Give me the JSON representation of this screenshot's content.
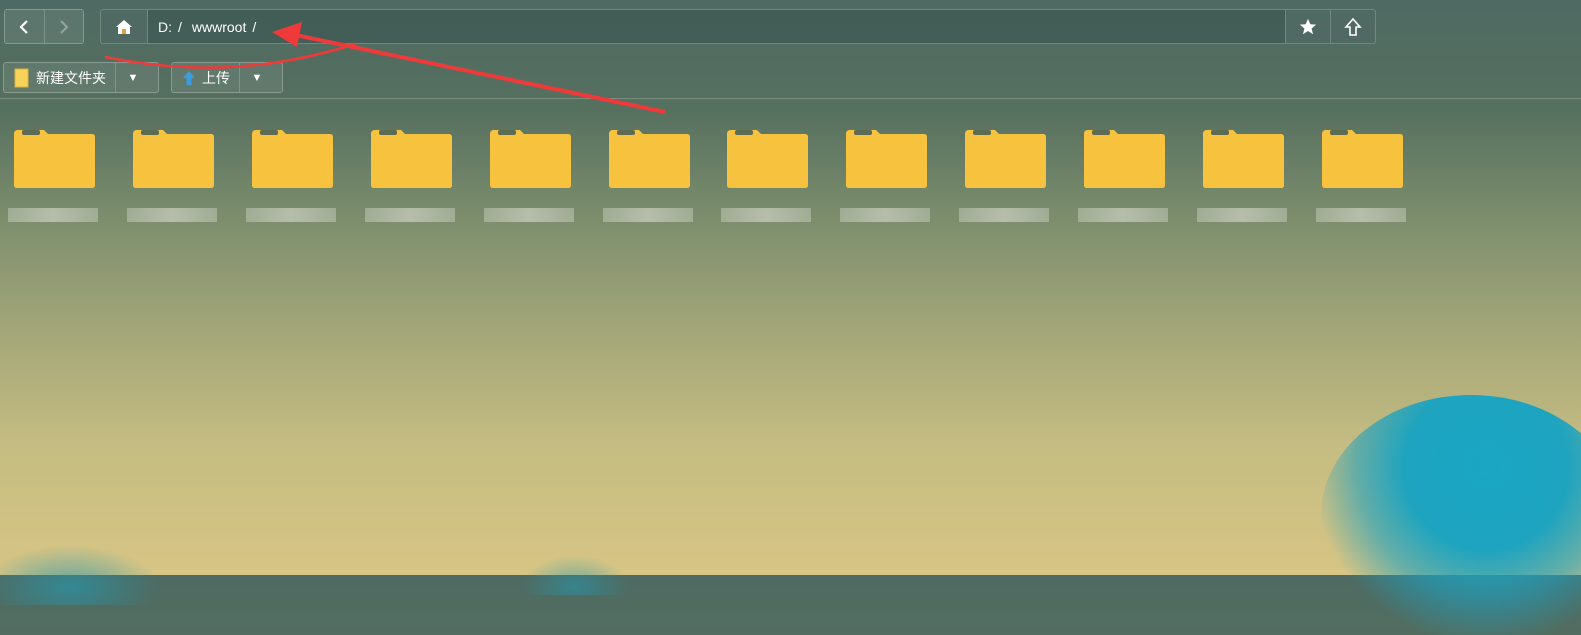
{
  "nav": {
    "back_icon": "chevron-left-icon",
    "forward_icon": "chevron-right-icon"
  },
  "address": {
    "home_icon": "home-icon",
    "crumbs": [
      "D:",
      "wwwroot"
    ],
    "separator": "/",
    "favorite_icon": "star-icon",
    "up_icon": "up-arrow-icon"
  },
  "toolbar": {
    "new_folder_label": "新建文件夹",
    "new_folder_icon": "folder-icon",
    "upload_label": "上传",
    "upload_icon": "upload-arrow-icon"
  },
  "folders": [
    {
      "name": ""
    },
    {
      "name": ""
    },
    {
      "name": ""
    },
    {
      "name": ""
    },
    {
      "name": ""
    },
    {
      "name": ""
    },
    {
      "name": ""
    },
    {
      "name": ""
    },
    {
      "name": ""
    },
    {
      "name": ""
    },
    {
      "name": ""
    },
    {
      "name": ""
    }
  ],
  "colors": {
    "folder": "#f7c33e",
    "folder_tab": "#5d6b55",
    "annotation": "#f03a3a"
  }
}
